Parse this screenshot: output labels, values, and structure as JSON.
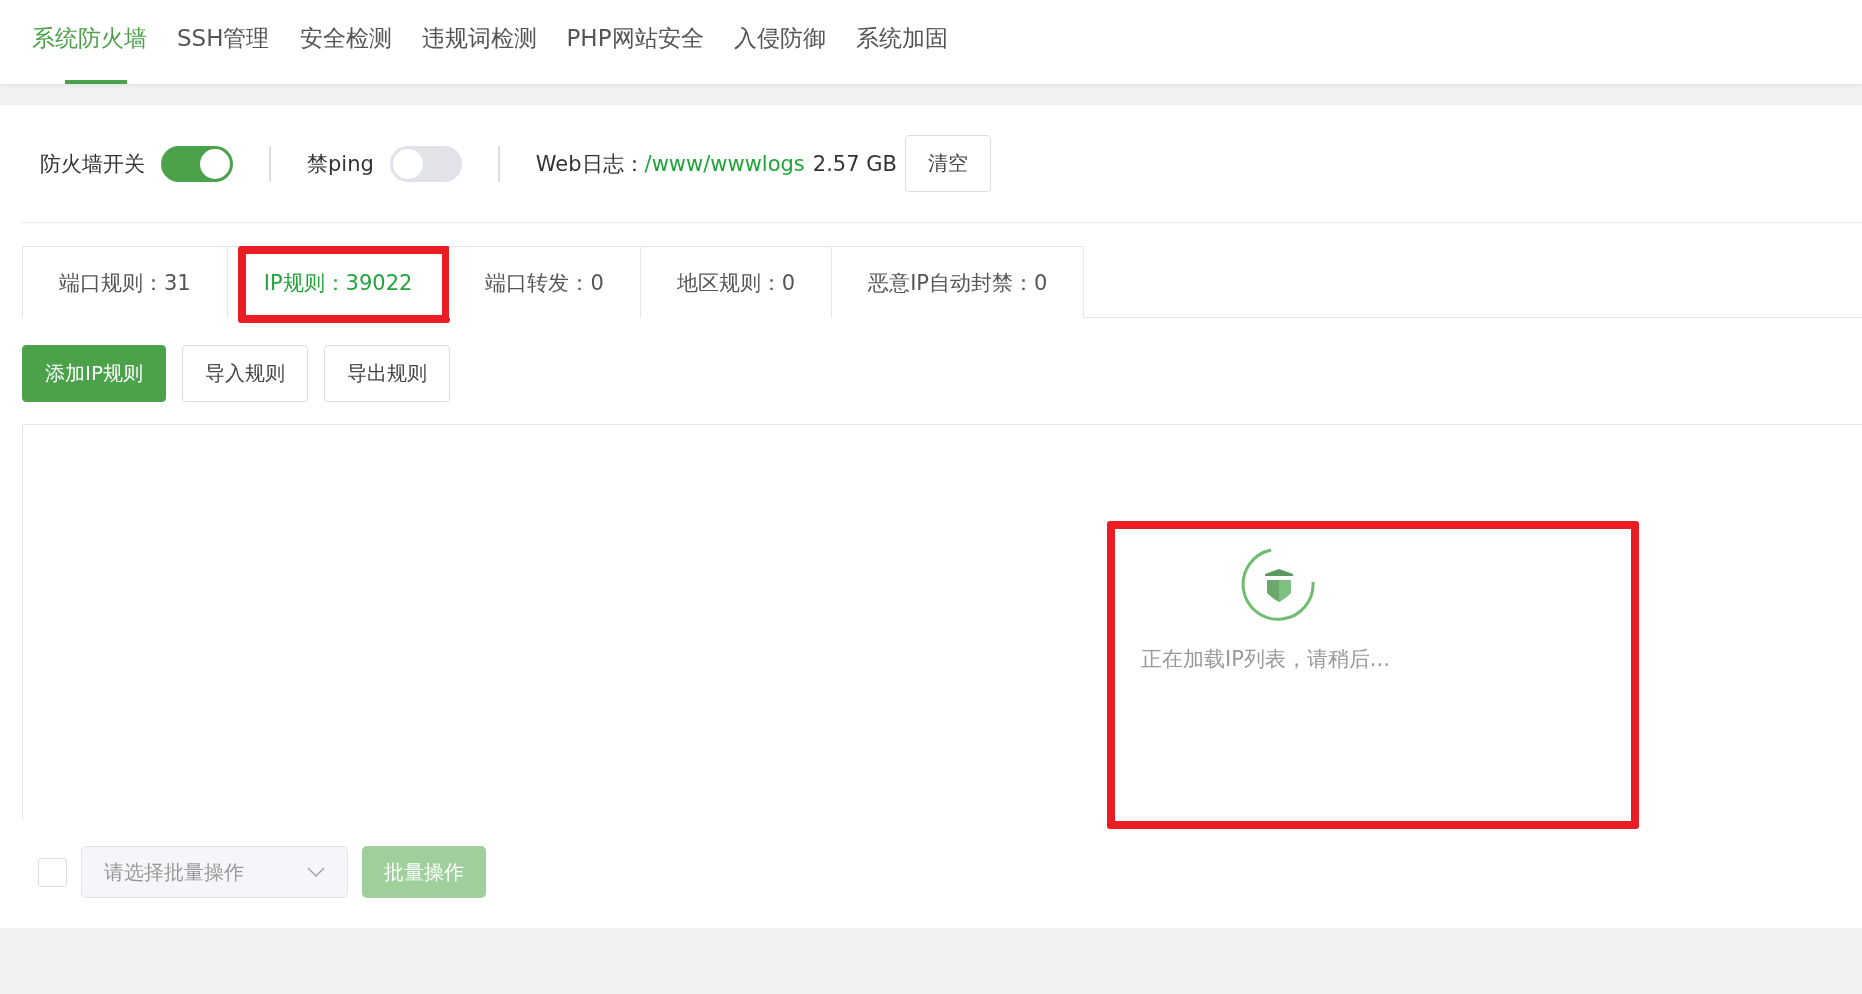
{
  "nav_tabs": [
    {
      "label": "系统防火墙",
      "selected": true
    },
    {
      "label": "SSH管理",
      "selected": false
    },
    {
      "label": "安全检测",
      "selected": false
    },
    {
      "label": "违规词检测",
      "selected": false
    },
    {
      "label": "PHP网站安全",
      "selected": false
    },
    {
      "label": "入侵防御",
      "selected": false
    },
    {
      "label": "系统加固",
      "selected": false
    }
  ],
  "toolbar": {
    "firewall_switch": {
      "label": "防火墙开关",
      "on": true
    },
    "ping_switch": {
      "label": "禁ping",
      "on": false
    },
    "web_log": {
      "label": "Web日志：",
      "path": "/www/wwwlogs",
      "size": "2.57 GB"
    },
    "clear_button": "清空"
  },
  "rule_tabs": [
    {
      "label": "端口规则：31",
      "selected": false,
      "highlighted": false
    },
    {
      "label": "IP规则：39022",
      "selected": true,
      "highlighted": true
    },
    {
      "label": "端口转发：0",
      "selected": false,
      "highlighted": false
    },
    {
      "label": "地区规则：0",
      "selected": false,
      "highlighted": false
    },
    {
      "label": "恶意IP自动封禁：0",
      "selected": false,
      "highlighted": false
    }
  ],
  "actions": [
    {
      "label": "添加IP规则",
      "kind": "primary"
    },
    {
      "label": "导入规则",
      "kind": "default"
    },
    {
      "label": "导出规则",
      "kind": "default"
    }
  ],
  "loading": {
    "message": "正在加载IP列表，请稍后...",
    "highlighted": true
  },
  "footer": {
    "select_all": {
      "checked": false
    },
    "batch_select": {
      "placeholder": "请选择批量操作"
    },
    "batch_button": {
      "label": "批量操作",
      "disabled": true
    }
  }
}
